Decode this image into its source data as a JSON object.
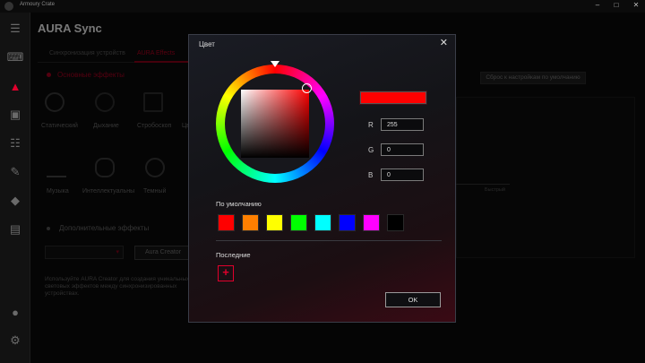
{
  "app": {
    "title": "Armoury Crate",
    "section": "AURA Sync"
  },
  "window_controls": {
    "minimize": "–",
    "maximize": "□",
    "close": "✕"
  },
  "rail_icons": [
    "menu-icon",
    "keyboard-icon",
    "aura-icon",
    "device-icon",
    "sliders-icon",
    "tools-icon",
    "tag-icon",
    "monitor-icon",
    "user-icon",
    "settings-icon"
  ],
  "background": {
    "tabs": [
      "Синхронизация устройств",
      "AURA Effects"
    ],
    "basic_effects_title": "Основные эффекты",
    "effects": [
      "Статический",
      "Дыхание",
      "Стробоскоп",
      "Цв",
      "Музыка",
      "Интеллектуальны",
      "Темный"
    ],
    "additional_effects_title": "Дополнительные эффекты",
    "aura_creator_button": "Aura Creator",
    "description": "Используйте AURA Creator для создания уникальных световых эффектов между синхронизированных устройствах.",
    "reset_button": "Сброс к настройкам по умолчанию",
    "speed_label": "Быстрый"
  },
  "dialog": {
    "title": "Цвет",
    "close": "✕",
    "preview_color": "#ff0000",
    "rgb": [
      {
        "label": "R",
        "value": "255"
      },
      {
        "label": "G",
        "value": "0"
      },
      {
        "label": "B",
        "value": "0"
      }
    ],
    "default_label": "По умолчанию",
    "default_colors": [
      "#ff0000",
      "#ff7f00",
      "#ffff00",
      "#00ff00",
      "#00ffff",
      "#0000ff",
      "#ff00ff",
      "#000000"
    ],
    "recent_label": "Последние",
    "add_recent": "+",
    "ok_label": "OK"
  }
}
